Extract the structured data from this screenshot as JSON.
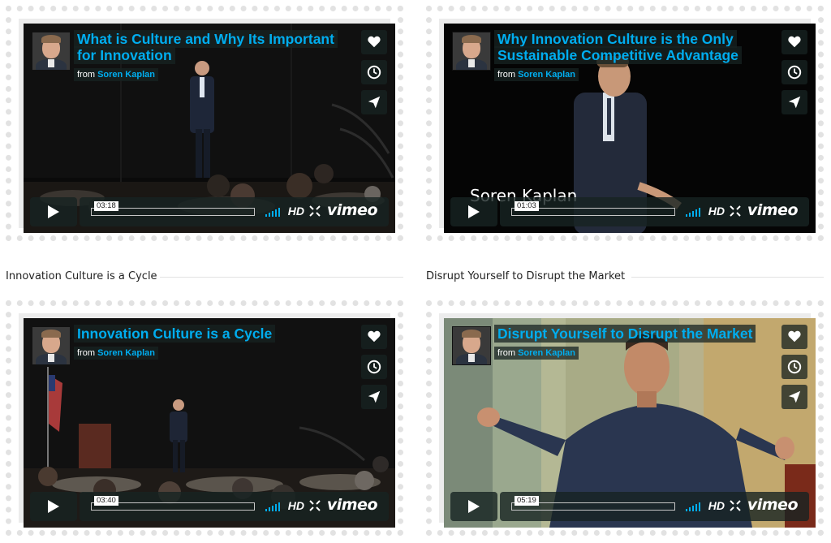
{
  "colors": {
    "accent": "#00adef",
    "overlay": "#172322",
    "card_background": "#ececec",
    "card_border": "#e2e2e2"
  },
  "common": {
    "from_label": "from",
    "author": "Soren Kaplan",
    "hd_label": "HD",
    "brand": "vimeo"
  },
  "icons": {
    "like": "heart-icon",
    "watch_later": "clock-icon",
    "share": "paper-plane-icon",
    "play": "play-icon",
    "volume": "volume-bars-icon",
    "fullscreen": "fullscreen-icon"
  },
  "section_labels": [
    "Innovation Culture is a Cycle",
    "Disrupt Yourself to Disrupt the Market"
  ],
  "videos": [
    {
      "title_line1": "What is Culture and Why Its Important",
      "title_line2": "for Innovation",
      "duration": "03:18"
    },
    {
      "title_line1": "Why Innovation Culture is the Only",
      "title_line2": "Sustainable Competitive Advantage",
      "duration": "01:03",
      "lower_third": "Soren Kaplan"
    },
    {
      "title_line1": "Innovation Culture is a Cycle",
      "title_line2": "",
      "duration": "03:40"
    },
    {
      "title_line1": "Disrupt Yourself to Disrupt the Market",
      "title_line2": "",
      "duration": "05:19"
    }
  ]
}
